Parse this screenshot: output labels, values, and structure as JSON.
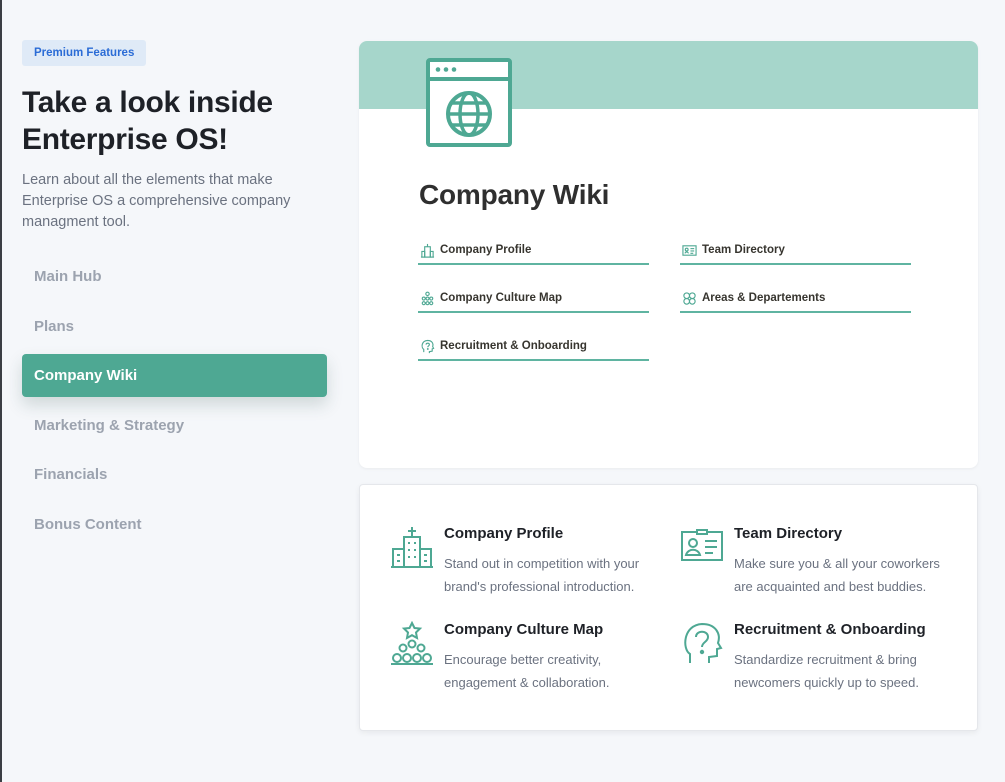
{
  "sidebar": {
    "badge": "Premium Features",
    "headline": "Take a look inside Enterprise OS!",
    "intro": "Learn about all the elements that make Enterprise OS a comprehensive company managment tool.",
    "nav": [
      {
        "label": "Main Hub",
        "active": false
      },
      {
        "label": "Plans",
        "active": false
      },
      {
        "label": "Company Wiki",
        "active": true
      },
      {
        "label": "Marketing & Strategy",
        "active": false
      },
      {
        "label": "Financials",
        "active": false
      },
      {
        "label": "Bonus Content",
        "active": false
      }
    ]
  },
  "preview": {
    "page_icon": "web-globe-icon",
    "title": "Company Wiki",
    "links": [
      {
        "label": "Company Profile",
        "icon": "building-icon"
      },
      {
        "label": "Team Directory",
        "icon": "id-card-icon"
      },
      {
        "label": "Company Culture Map",
        "icon": "org-chart-icon"
      },
      {
        "label": "Areas & Departements",
        "icon": "clover-icon"
      },
      {
        "label": "Recruitment & Onboarding",
        "icon": "question-head-icon"
      }
    ]
  },
  "features": [
    {
      "title": "Company Profile",
      "desc": "Stand out in competition with your brand's professional introduction.",
      "icon": "building-icon"
    },
    {
      "title": "Team Directory",
      "desc": "Make sure you & all your coworkers are acquainted and best buddies.",
      "icon": "id-card-icon"
    },
    {
      "title": "Company Culture Map",
      "desc": "Encourage better creativity, engagement & collaboration.",
      "icon": "org-chart-icon"
    },
    {
      "title": "Recruitment & Onboarding",
      "desc": "Standardize recruitment & bring newcomers quickly up to speed.",
      "icon": "question-head-icon"
    }
  ],
  "colors": {
    "accent": "#4ea893",
    "cover": "#a6d6cb",
    "icon": "#4ea893",
    "badge_bg": "#dfeaf7",
    "badge_text": "#2b6cd6"
  }
}
